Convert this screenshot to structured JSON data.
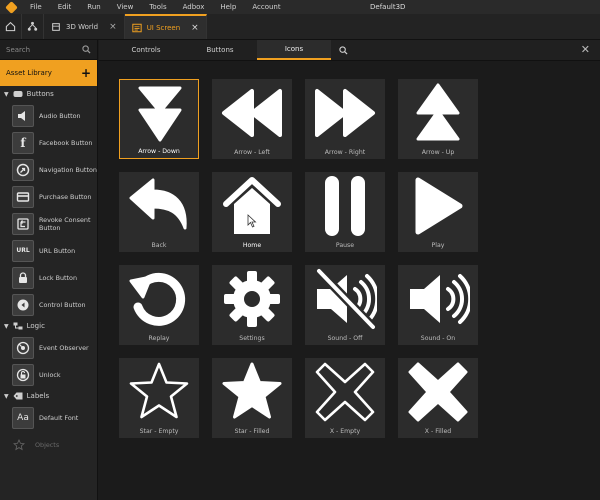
{
  "menubar": {
    "items": [
      "File",
      "Edit",
      "Run",
      "View",
      "Tools",
      "Adbox",
      "Help",
      "Account"
    ],
    "title": "Default3D"
  },
  "tabs": [
    {
      "label": "3D World",
      "active": false
    },
    {
      "label": "UI Screen",
      "active": true
    }
  ],
  "sidebar": {
    "search_placeholder": "Search",
    "asset_library": "Asset Library",
    "add_symbol": "+",
    "groups": {
      "buttons": "Buttons",
      "logic": "Logic",
      "labels": "Labels",
      "objects": "Objects"
    },
    "button_items": [
      "Audio Button",
      "Facebook Button",
      "Navigation Button",
      "Purchase Button",
      "Revoke Consent Button",
      "URL Button",
      "Lock Button",
      "Control Button"
    ],
    "logic_items": [
      "Event Observer",
      "Unlock"
    ],
    "label_items": [
      "Default Font"
    ],
    "thumb_text": {
      "facebook": "f",
      "url": "URL",
      "font": "Aa"
    }
  },
  "panel": {
    "subtabs": [
      "Controls",
      "Buttons",
      "Icons"
    ],
    "active_subtab": "Icons",
    "close_symbol": "✕"
  },
  "icons": [
    {
      "label": "Arrow - Down",
      "icon": "arrow-down-icon"
    },
    {
      "label": "Arrow - Left",
      "icon": "arrow-left-icon"
    },
    {
      "label": "Arrow - Right",
      "icon": "arrow-right-icon"
    },
    {
      "label": "Arrow - Up",
      "icon": "arrow-up-icon"
    },
    {
      "label": "Back",
      "icon": "back-icon"
    },
    {
      "label": "Home",
      "icon": "home-icon"
    },
    {
      "label": "Pause",
      "icon": "pause-icon"
    },
    {
      "label": "Play",
      "icon": "play-icon"
    },
    {
      "label": "Replay",
      "icon": "replay-icon"
    },
    {
      "label": "Settings",
      "icon": "settings-icon"
    },
    {
      "label": "Sound - Off",
      "icon": "sound-off-icon"
    },
    {
      "label": "Sound - On",
      "icon": "sound-on-icon"
    },
    {
      "label": "Star - Empty",
      "icon": "star-empty-icon"
    },
    {
      "label": "Star - Filled",
      "icon": "star-filled-icon"
    },
    {
      "label": "X - Empty",
      "icon": "x-empty-icon"
    },
    {
      "label": "X - Filled",
      "icon": "x-filled-icon"
    }
  ],
  "selected_icon": "Arrow - Down",
  "hovered_icon": "Home",
  "colors": {
    "accent": "#f0a020",
    "tile": "#2c2c2c",
    "background": "#1b1b1b"
  }
}
